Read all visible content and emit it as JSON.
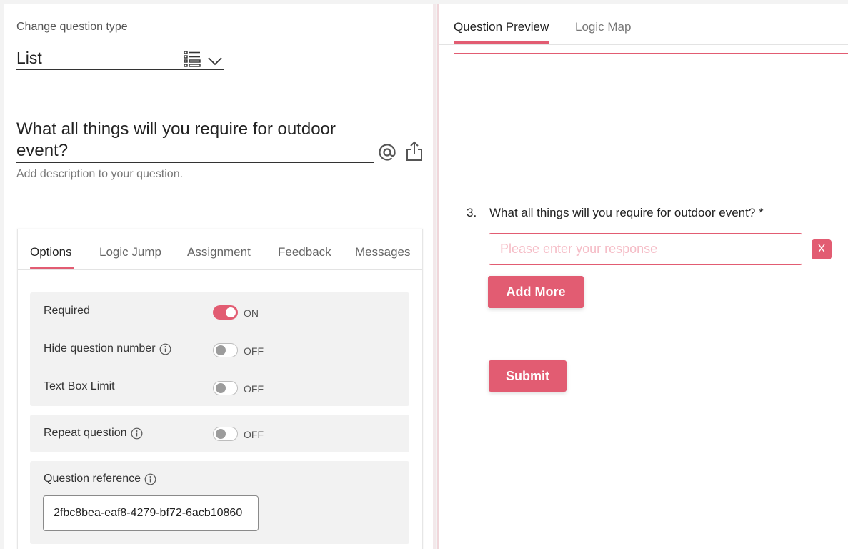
{
  "editor": {
    "change_type_label": "Change question type",
    "question_type": "List",
    "question_title": "What all things will you require for outdoor event?",
    "description_placeholder": "Add description to your question."
  },
  "settings_tabs": [
    "Options",
    "Logic Jump",
    "Assignment",
    "Feedback",
    "Messages"
  ],
  "options": {
    "required": {
      "label": "Required",
      "state": "ON"
    },
    "hide_number": {
      "label": "Hide question number",
      "state": "OFF"
    },
    "text_box_limit": {
      "label": "Text Box Limit",
      "state": "OFF"
    },
    "repeat_question": {
      "label": "Repeat question",
      "state": "OFF"
    },
    "question_reference": {
      "label": "Question reference",
      "value": "2fbc8bea-eaf8-4279-bf72-6acb10860"
    }
  },
  "preview_tabs": [
    "Question Preview",
    "Logic Map"
  ],
  "preview": {
    "number": "3.",
    "question": "What all things will you require for outdoor event? *",
    "response_placeholder": "Please enter your response",
    "remove_label": "X",
    "add_more_label": "Add More",
    "submit_label": "Submit"
  },
  "colors": {
    "accent": "#e25c72"
  }
}
